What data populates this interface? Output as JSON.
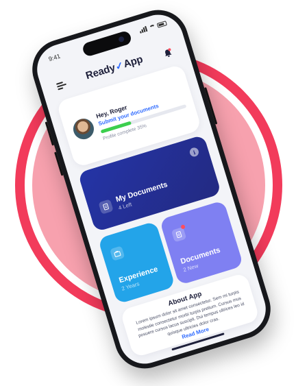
{
  "status": {
    "time": "9:41"
  },
  "app": {
    "logo_left": "Ready",
    "logo_right": "App"
  },
  "profile": {
    "greeting": "Hey, Roger",
    "submit_link": "Submit your documents",
    "progress_percent": 35,
    "progress_label": "Profile complete 35%"
  },
  "tiles": {
    "my_documents": {
      "title": "My Documents",
      "subtitle": "4 Left",
      "info_glyph": "i"
    },
    "experience": {
      "title": "Experience",
      "subtitle": "2 Years"
    },
    "documents": {
      "title": "Documents",
      "subtitle": "2 New"
    }
  },
  "about": {
    "title": "About App",
    "body": "Lorem ipsum dolor sit amet consectetur. Sem mi turpis molestie consectetur morbi turpis pretium. Cursus mus posuere cursus lacus suscipit. Dui tempus ultrices leo id quisque ultricies dolor cras.",
    "read_more": "Read More"
  },
  "icons": {
    "menu": "hamburger-menu-icon",
    "bell": "notification-bell-icon",
    "my_documents": "document-icon",
    "experience": "briefcase-icon",
    "documents": "document-stack-icon",
    "info": "info-icon"
  },
  "colors": {
    "ring": "#f23b5b",
    "disc": "#f7a1ae",
    "accent_blue": "#2f6bff",
    "progress_green": "#3ccf4e",
    "tile_navy": "#232a82",
    "tile_sky": "#23a4e9",
    "tile_violet": "#7f80f2"
  }
}
